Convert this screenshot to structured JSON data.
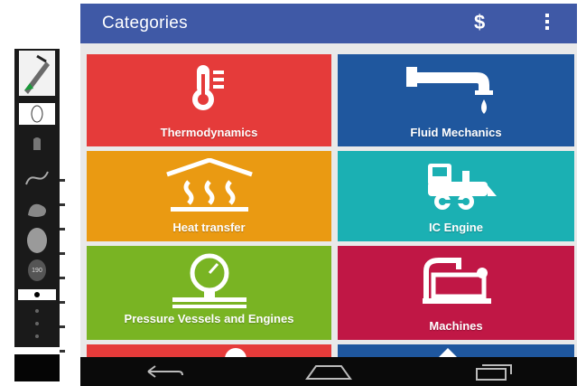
{
  "appbar": {
    "title": "Categories",
    "currency_glyph": "$"
  },
  "categories": [
    {
      "label": "Thermodynamics",
      "color": "#e53b3a",
      "icon": "thermometer-icon"
    },
    {
      "label": "Fluid Mechanics",
      "color": "#1f579e",
      "icon": "faucet-icon"
    },
    {
      "label": "Heat transfer",
      "color": "#ea9a12",
      "icon": "heat-waves-icon"
    },
    {
      "label": "IC Engine",
      "color": "#1bb0b3",
      "icon": "locomotive-icon"
    },
    {
      "label": "Pressure Vessels and Engines",
      "color": "#79b423",
      "icon": "pressure-gauge-icon"
    },
    {
      "label": "Machines",
      "color": "#c01745",
      "icon": "machine-icon"
    },
    {
      "label": "",
      "color": "#e53b3a",
      "icon": "partial-icon"
    },
    {
      "label": "",
      "color": "#1f579e",
      "icon": "partial-icon"
    }
  ],
  "side_panel": {
    "size_badge": "190"
  },
  "navbar": {
    "items": [
      "back",
      "home",
      "recents"
    ]
  }
}
